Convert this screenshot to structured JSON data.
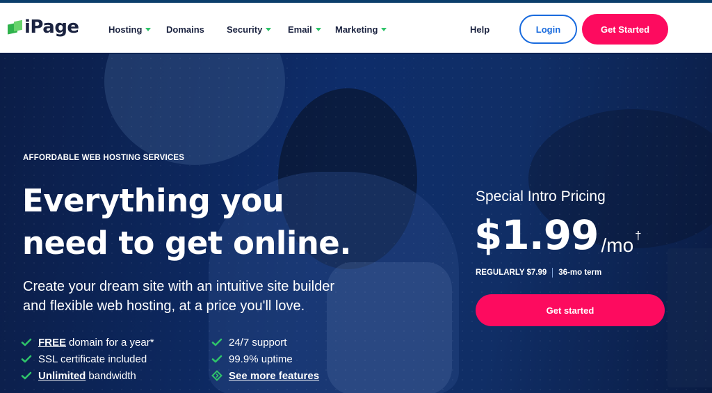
{
  "brand": {
    "name": "iPage",
    "accent": "#fd0b5f",
    "green": "#2fc36a",
    "blue": "#196bde"
  },
  "nav": {
    "items": [
      {
        "label": "Hosting",
        "has_dropdown": true
      },
      {
        "label": "Domains",
        "has_dropdown": false
      },
      {
        "label": "Security",
        "has_dropdown": true
      },
      {
        "label": "Email",
        "has_dropdown": true
      },
      {
        "label": "Marketing",
        "has_dropdown": true
      }
    ],
    "help": "Help",
    "login": "Login",
    "get_started": "Get Started"
  },
  "hero": {
    "eyebrow": "AFFORDABLE WEB HOSTING SERVICES",
    "headline_line1": "Everything you",
    "headline_line2": "need to get online.",
    "sub_line1": "Create your dream site with an intuitive site builder",
    "sub_line2": "and flexible web hosting, at a price you'll love.",
    "features_left": [
      {
        "emphasis": "FREE",
        "text": "domain for a year*"
      },
      {
        "emphasis": "",
        "text": "SSL certificate included"
      },
      {
        "emphasis": "Unlimited",
        "text": "bandwidth"
      }
    ],
    "features_right": [
      {
        "text": "24/7 support"
      },
      {
        "text": "99.9% uptime"
      },
      {
        "text": "See more features",
        "is_link": true
      }
    ]
  },
  "pricing": {
    "label": "Special Intro Pricing",
    "price": "$1.99",
    "unit": "/mo",
    "dagger": "†",
    "regular": "REGULARLY $7.99",
    "term": "36-mo term",
    "cta": "Get started"
  }
}
